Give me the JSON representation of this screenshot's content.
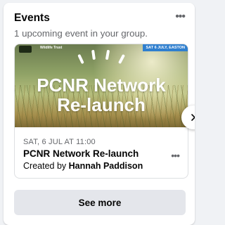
{
  "widget": {
    "title": "Events",
    "subtitle": "1 upcoming event in your group.",
    "menu_icon": "more-horizontal-icon"
  },
  "event": {
    "banner": {
      "org_name": "Wildlife Trust",
      "date_tag": "SAT 6 JULY, EASTON",
      "headline_line1": "PCNR Network",
      "headline_line2": "Re-launch"
    },
    "date": "SAT, 6 JUL AT 11:00",
    "title": "PCNR Network Re-launch",
    "created_by_prefix": "Created by",
    "creator": "Hannah Paddison",
    "menu_icon": "more-horizontal-icon"
  },
  "carousel": {
    "next_icon": "chevron-right-icon"
  },
  "see_more_label": "See more",
  "colors": {
    "accent_blue": "#2f7fcf",
    "button_bg": "#e4e6eb",
    "secondary_text": "#65676b"
  }
}
